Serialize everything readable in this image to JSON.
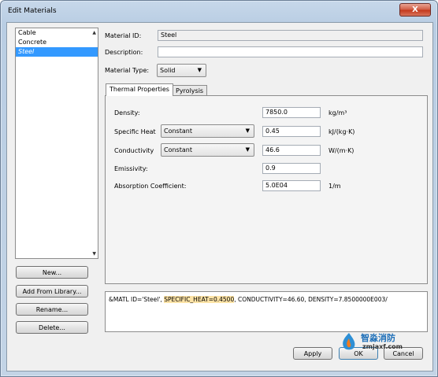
{
  "window": {
    "title": "Edit Materials",
    "close_symbol": "X"
  },
  "material_list": {
    "items": [
      {
        "label": "Cable"
      },
      {
        "label": "Concrete"
      },
      {
        "label": "Steel",
        "selected": true
      }
    ]
  },
  "left_buttons": {
    "new": "New...",
    "add_from_library": "Add From Library...",
    "rename": "Rename...",
    "delete": "Delete..."
  },
  "form": {
    "material_id_label": "Material ID:",
    "material_id_value": "Steel",
    "description_label": "Description:",
    "description_value": "",
    "material_type_label": "Material Type:",
    "material_type_value": "Solid"
  },
  "tabs": {
    "thermal": "Thermal Properties",
    "pyrolysis": "Pyrolysis"
  },
  "properties": {
    "density": {
      "label": "Density:",
      "value": "7850.0",
      "unit": "kg/m³"
    },
    "specific_heat": {
      "label": "Specific Heat",
      "mode": "Constant",
      "value": "0.45",
      "unit": "kJ/(kg·K)"
    },
    "conductivity": {
      "label": "Conductivity",
      "mode": "Constant",
      "value": "46.6",
      "unit": "W/(m·K)"
    },
    "emissivity": {
      "label": "Emissivity:",
      "value": "0.9"
    },
    "absorption": {
      "label": "Absorption Coefficient:",
      "value": "5.0E04",
      "unit": "1/m"
    }
  },
  "output": {
    "prefix": "&MATL ID='Steel', ",
    "highlight": "SPECIFIC_HEAT=0.4500",
    "suffix": ", CONDUCTIVITY=46.60, DENSITY=7.8500000E003/"
  },
  "footer": {
    "apply": "Apply",
    "ok": "OK",
    "cancel": "Cancel"
  },
  "watermark": {
    "cn": "智淼消防",
    "url": "zmjaxf.com"
  },
  "colors": {
    "selection": "#3399ff",
    "highlight": "#fde3a6",
    "close_button": "#c43a1e"
  }
}
